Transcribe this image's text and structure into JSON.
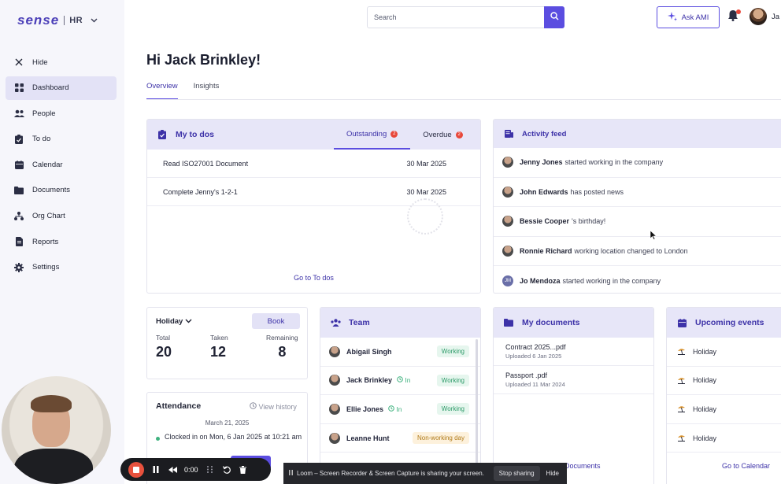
{
  "brand": {
    "logo": "sense",
    "product": "HR"
  },
  "sidebar": {
    "items": [
      {
        "label": "Hide",
        "icon": "close-icon"
      },
      {
        "label": "Dashboard",
        "icon": "dashboard-icon",
        "active": true
      },
      {
        "label": "People",
        "icon": "people-icon"
      },
      {
        "label": "To do",
        "icon": "clipboard-icon"
      },
      {
        "label": "Calendar",
        "icon": "calendar-icon"
      },
      {
        "label": "Documents",
        "icon": "folder-icon"
      },
      {
        "label": "Org Chart",
        "icon": "org-chart-icon"
      },
      {
        "label": "Reports",
        "icon": "reports-icon"
      },
      {
        "label": "Settings",
        "icon": "gear-icon"
      }
    ]
  },
  "topbar": {
    "search_placeholder": "Search",
    "ask_ami_label": "Ask AMI",
    "user_truncated": "Ja"
  },
  "main": {
    "greeting": "Hi Jack Brinkley!",
    "tabs": [
      {
        "label": "Overview",
        "active": true
      },
      {
        "label": "Insights"
      }
    ]
  },
  "todos": {
    "title": "My to dos",
    "tabs": [
      {
        "label": "Outstanding",
        "count": "2",
        "active": true
      },
      {
        "label": "Overdue",
        "count": "2"
      }
    ],
    "rows": [
      {
        "task": "Read ISO27001 Document",
        "date": "30 Mar 2025"
      },
      {
        "task": "Complete Jenny's 1-2-1",
        "date": "30 Mar 2025"
      }
    ],
    "footer_link": "Go to To dos"
  },
  "activity": {
    "title": "Activity feed",
    "rows": [
      {
        "name": "Jenny Jones",
        "text": "started working in the company"
      },
      {
        "name": "John Edwards",
        "text": "has posted news"
      },
      {
        "name": "Bessie Cooper",
        "text": "'s birthday!"
      },
      {
        "name": "Ronnie Richard",
        "text": "working location changed to London"
      },
      {
        "name": "Jo Mendoza",
        "text": "started working in the company",
        "initials": "JM"
      }
    ]
  },
  "holiday": {
    "type": "Holiday",
    "book_label": "Book",
    "stats": [
      {
        "label": "Total",
        "value": "20"
      },
      {
        "label": "Taken",
        "value": "12"
      },
      {
        "label": "Remaining",
        "value": "8"
      }
    ]
  },
  "attendance": {
    "title": "Attendance",
    "history_link": "View history",
    "date": "March 21, 2025",
    "status": "Clocked in on Mon, 6 Jan 2025 at 10:21 am"
  },
  "team": {
    "title": "Team",
    "members": [
      {
        "name": "Abigail Singh",
        "in": "",
        "status": "Working"
      },
      {
        "name": "Jack Brinkley",
        "in": "In",
        "status": "Working"
      },
      {
        "name": "Ellie Jones",
        "in": "In",
        "status": "Working"
      },
      {
        "name": "Leanne Hunt",
        "in": "",
        "status": "Non-working day"
      }
    ]
  },
  "documents": {
    "title": "My documents",
    "items": [
      {
        "name": "Contract 2025...pdf",
        "sub": "Uploaded 6 Jan 2025"
      },
      {
        "name": "Passport .pdf",
        "sub": "Uploaded 11 Mar 2024"
      }
    ],
    "footer_link": "Documents"
  },
  "events": {
    "title": "Upcoming events",
    "items": [
      "Holiday",
      "Holiday",
      "Holiday",
      "Holiday"
    ],
    "footer_link": "Go to Calendar"
  },
  "loom": {
    "timer": "0:00",
    "share_text": "Loom – Screen Recorder & Screen Capture is sharing your screen.",
    "stop_sharing": "Stop sharing",
    "hide": "Hide"
  },
  "colors": {
    "accent": "#5b4de0",
    "accent_light": "#e7e6f8",
    "badge": "#e8483b",
    "working": "#2c9a68"
  }
}
